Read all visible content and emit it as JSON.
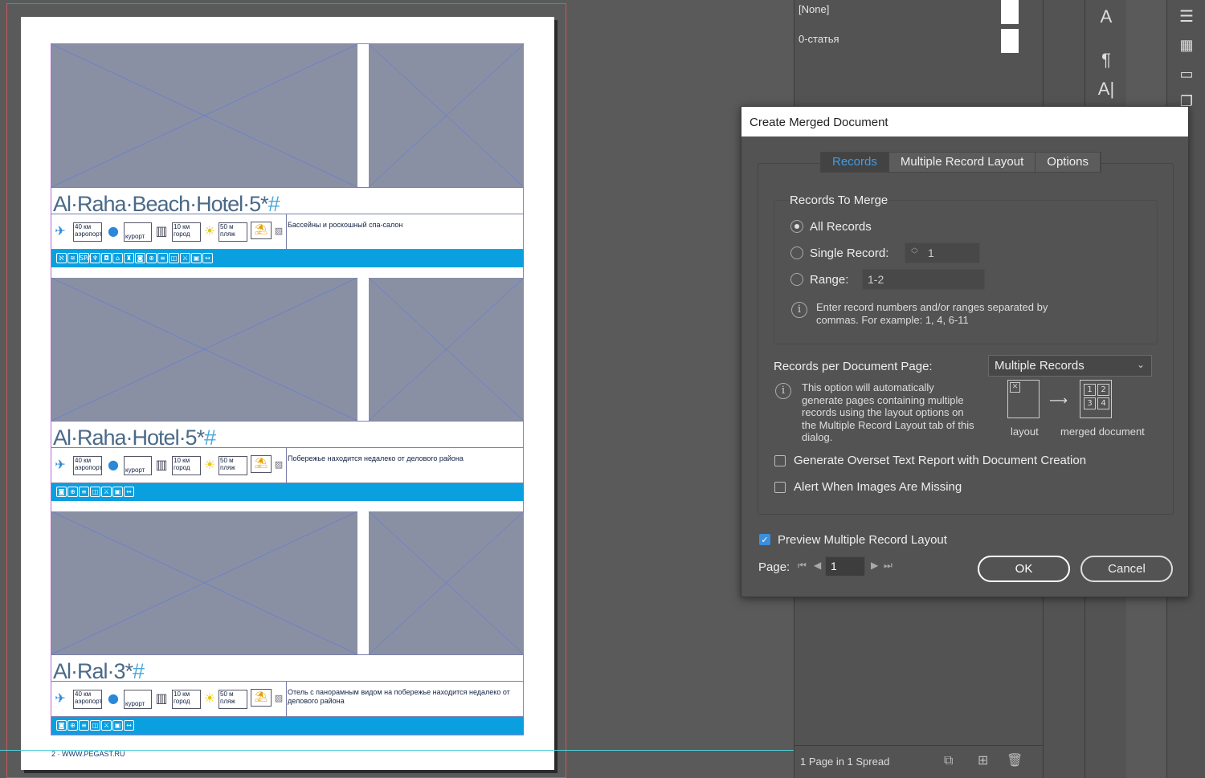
{
  "document": {
    "records": [
      {
        "title": "Al·Raha·Beach·Hotel·5*",
        "hash": "#",
        "airport_dist": "40 км",
        "airport_label": "аэропорт",
        "resort_label": "курорт",
        "city_dist": "10 км",
        "city_label": "город",
        "beach_dist": "50 м",
        "beach_label": "пляж",
        "description": "Бассейны и роскошный спа-салон",
        "bar_icons": [
          "ℵ",
          "≋",
          "SPA",
          "♆",
          "◘",
          "⌂",
          "♜",
          "◙",
          "⊕",
          "≡",
          "◫",
          "⚔",
          "▣",
          "↔"
        ]
      },
      {
        "title": "Al·Raha·Hotel·5*",
        "hash": "#",
        "airport_dist": "40 км",
        "airport_label": "аэропорт",
        "resort_label": "курорт",
        "city_dist": "10 км",
        "city_label": "город",
        "beach_dist": "50 м",
        "beach_label": "пляж",
        "description": "Побережье находится недалеко от делового района",
        "bar_icons": [
          "◙",
          "⊕",
          "≡",
          "◫",
          "⚔",
          "▣",
          "↔"
        ]
      },
      {
        "title": "Al·Ral·3*",
        "hash": "#",
        "airport_dist": "40 км",
        "airport_label": "аэропорт",
        "resort_label": "курорт",
        "city_dist": "10 км",
        "city_label": "город",
        "beach_dist": "50 м",
        "beach_label": "пляж",
        "description": "Отель с панорамным видом на побережье находится недалеко от делового района",
        "bar_icons": [
          "◙",
          "⊕",
          "≡",
          "◫",
          "⚔",
          "▣",
          "↔"
        ]
      }
    ],
    "footer_page": "2",
    "footer_url": "WWW.PEGAST.RU"
  },
  "panel": {
    "swatches": [
      "[None]",
      "0-статья"
    ],
    "pages_status": "1 Page in 1 Spread"
  },
  "dialog": {
    "title": "Create Merged Document",
    "tabs": [
      "Records",
      "Multiple Record Layout",
      "Options"
    ],
    "active_tab": "Records",
    "records_to_merge_label": "Records To Merge",
    "all_records_label": "All Records",
    "single_record_label": "Single Record:",
    "single_record_value": "1",
    "range_label": "Range:",
    "range_value": "1-2",
    "range_hint": "Enter record numbers and/or ranges separated by commas. For example: 1, 4, 6-11",
    "records_per_page_label": "Records per Document Page:",
    "records_per_page_value": "Multiple Records",
    "records_per_page_hint": "This option will automatically generate pages containing multiple records using the layout options on the Multiple Record Layout tab of this dialog.",
    "diagram_layout_label": "layout",
    "diagram_merged_label": "merged document",
    "diagram_cells": [
      "1",
      "2",
      "3",
      "4"
    ],
    "overset_label": "Generate Overset Text Report with Document Creation",
    "overset_checked": false,
    "missing_images_label": "Alert When Images Are Missing",
    "missing_images_checked": false,
    "preview_label": "Preview Multiple Record Layout",
    "preview_checked": true,
    "page_label": "Page:",
    "page_value": "1",
    "ok_label": "OK",
    "cancel_label": "Cancel"
  },
  "colors": {
    "accent": "#3d9de8",
    "bar": "#0aa0e0",
    "placeholder": "#8a90a4"
  }
}
